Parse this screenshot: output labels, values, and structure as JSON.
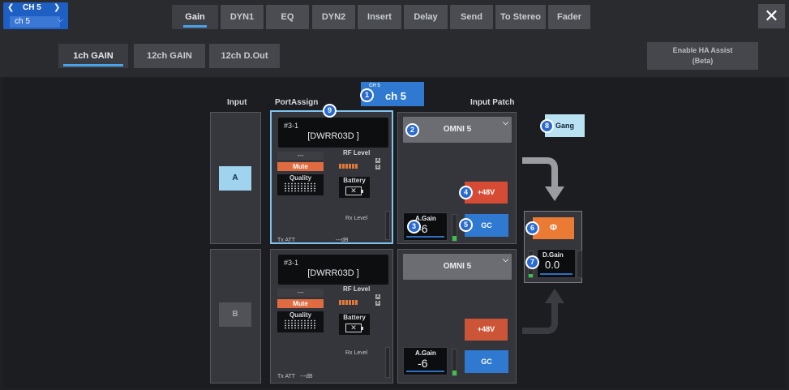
{
  "channel": {
    "label": "CH 5",
    "name": "ch 5"
  },
  "tabs": [
    {
      "label": "Gain"
    },
    {
      "label": "DYN1"
    },
    {
      "label": "EQ"
    },
    {
      "label": "DYN2"
    },
    {
      "label": "Insert"
    },
    {
      "label": "Delay"
    },
    {
      "label": "Send"
    },
    {
      "label": "To Stereo"
    },
    {
      "label": "Fader"
    }
  ],
  "subtabs": [
    {
      "label": "1ch GAIN"
    },
    {
      "label": "12ch GAIN"
    },
    {
      "label": "12ch D.Out"
    }
  ],
  "ha_assist": {
    "line1": "Enable HA Assist",
    "line2": "(Beta)"
  },
  "headers": {
    "input": "Input",
    "port_assign": "PortAssign",
    "input_patch": "Input Patch"
  },
  "ch_badge": {
    "small": "CH 5",
    "big": "ch 5"
  },
  "rows": [
    {
      "input_label": "A",
      "device_id": "#3-1",
      "device_name": "[DWRR03D ]",
      "dash": "---",
      "mute": "Mute",
      "quality": "Quality",
      "rf_level": "RF Level",
      "battery": "Battery",
      "rx_level": "Rx Level",
      "tx_att": "Tx ATT",
      "tx_att_val": "---dB",
      "patch": "OMNI 5",
      "phantom": "+48V",
      "again_label": "A.Gain",
      "again_value": "-6",
      "gc": "GC"
    },
    {
      "input_label": "B",
      "device_id": "#3-1",
      "device_name": "[DWRR03D ]",
      "dash": "---",
      "mute": "Mute",
      "quality": "Quality",
      "rf_level": "RF Level",
      "battery": "Battery",
      "rx_level": "Rx Level",
      "tx_att": "Tx ATT",
      "tx_att_val": "---dB",
      "patch": "OMNI 5",
      "phantom": "+48V",
      "again_label": "A.Gain",
      "again_value": "-6",
      "gc": "GC"
    }
  ],
  "gang": "Gang",
  "phase_symbol": "Φ",
  "dgain": {
    "label": "D.Gain",
    "value": "0.0"
  },
  "markers": [
    "1",
    "2",
    "3",
    "4",
    "5",
    "6",
    "7",
    "8",
    "9"
  ],
  "colors": {
    "accent": "#2f79d0",
    "phantom": "#d64b33",
    "phase": "#ea7a34",
    "gang": "#b9e3f3",
    "mute": "#e06b40"
  }
}
